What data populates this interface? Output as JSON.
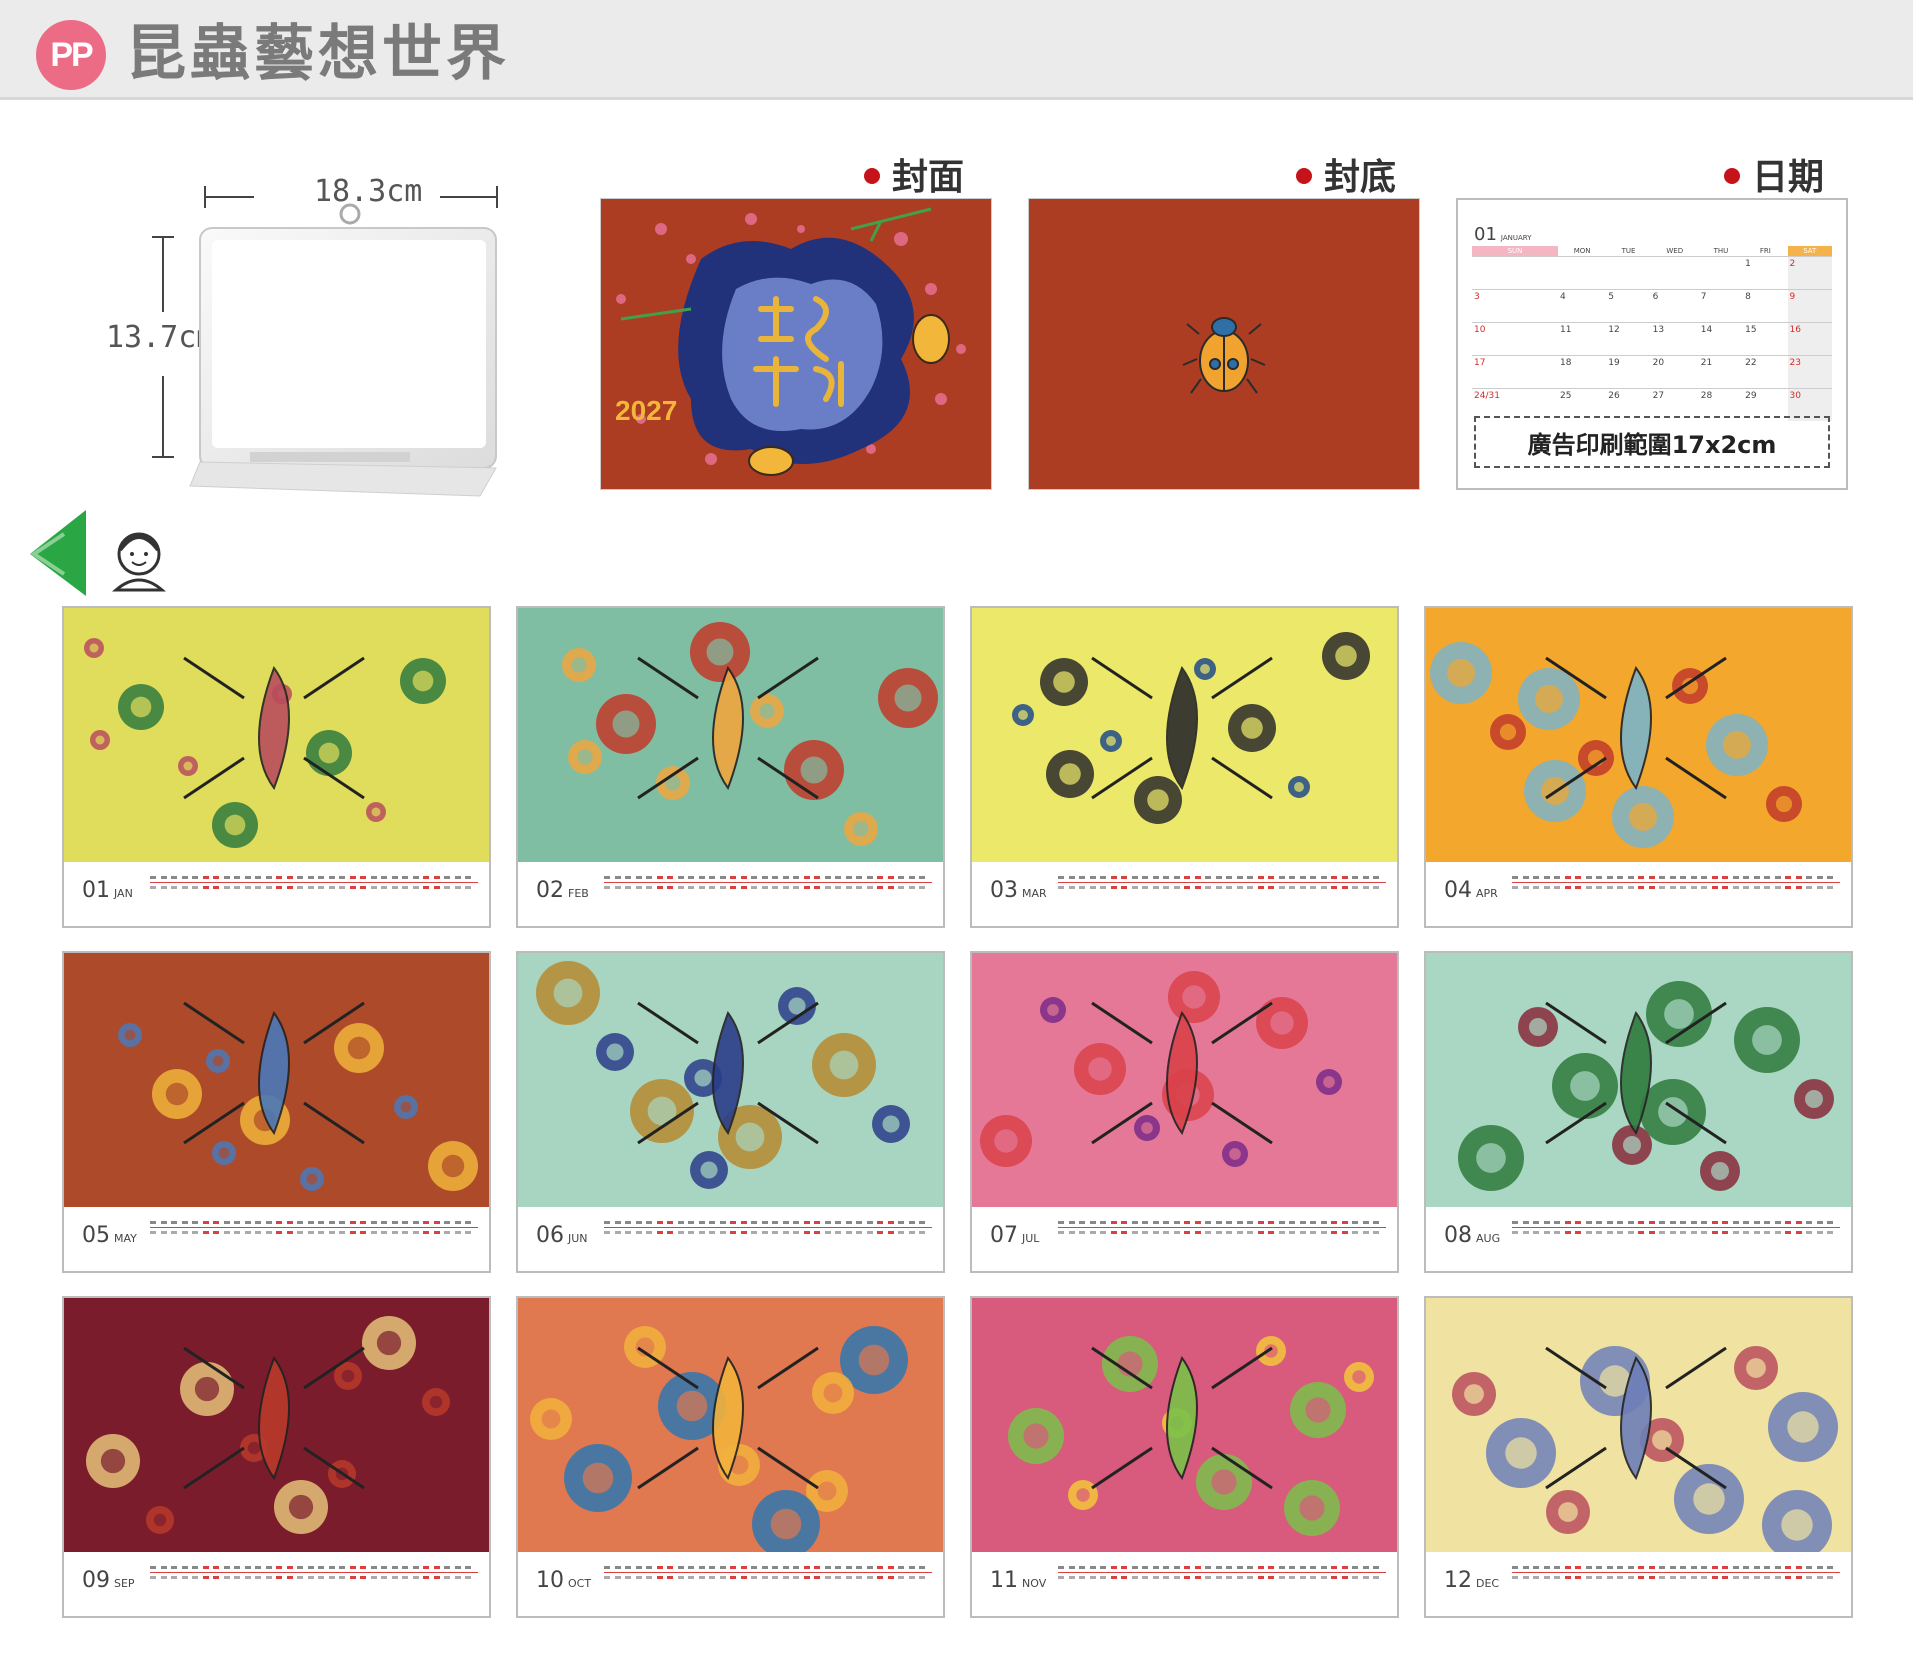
{
  "header": {
    "logo": "PP",
    "title": "昆蟲藝想世界"
  },
  "product": {
    "width_label": "18.3cm",
    "height_label": "13.7cm"
  },
  "previews": {
    "cover_label": "封面",
    "back_label": "封底",
    "date_label": "日期",
    "cover_year": "2027",
    "ad_text": "廣告印刷範圍17x2cm",
    "calendar": {
      "month": "01",
      "month_name": "JANUARY",
      "weekdays": [
        "SUN",
        "MON",
        "TUE",
        "WED",
        "THU",
        "FRI",
        "SAT"
      ],
      "weeks": [
        [
          "",
          "",
          "",
          "",
          "",
          "1",
          "2"
        ],
        [
          "3",
          "4",
          "5",
          "6",
          "7",
          "8",
          "9"
        ],
        [
          "10",
          "11",
          "12",
          "13",
          "14",
          "15",
          "16"
        ],
        [
          "17",
          "18",
          "19",
          "20",
          "21",
          "22",
          "23"
        ],
        [
          "24/31",
          "25",
          "26",
          "27",
          "28",
          "29",
          "30"
        ]
      ]
    }
  },
  "months": [
    {
      "num": "01",
      "abbr": "JAN"
    },
    {
      "num": "02",
      "abbr": "FEB"
    },
    {
      "num": "03",
      "abbr": "MAR"
    },
    {
      "num": "04",
      "abbr": "APR"
    },
    {
      "num": "05",
      "abbr": "MAY"
    },
    {
      "num": "06",
      "abbr": "JUN"
    },
    {
      "num": "07",
      "abbr": "JUL"
    },
    {
      "num": "08",
      "abbr": "AUG"
    },
    {
      "num": "09",
      "abbr": "SEP"
    },
    {
      "num": "10",
      "abbr": "OCT"
    },
    {
      "num": "11",
      "abbr": "NOV"
    },
    {
      "num": "12",
      "abbr": "DEC"
    }
  ],
  "colors": {
    "accent_red": "#c4141a",
    "cover_bg": "#ad3d22",
    "logo_pink": "#ec6c86",
    "arrow_green": "#2aa744"
  }
}
